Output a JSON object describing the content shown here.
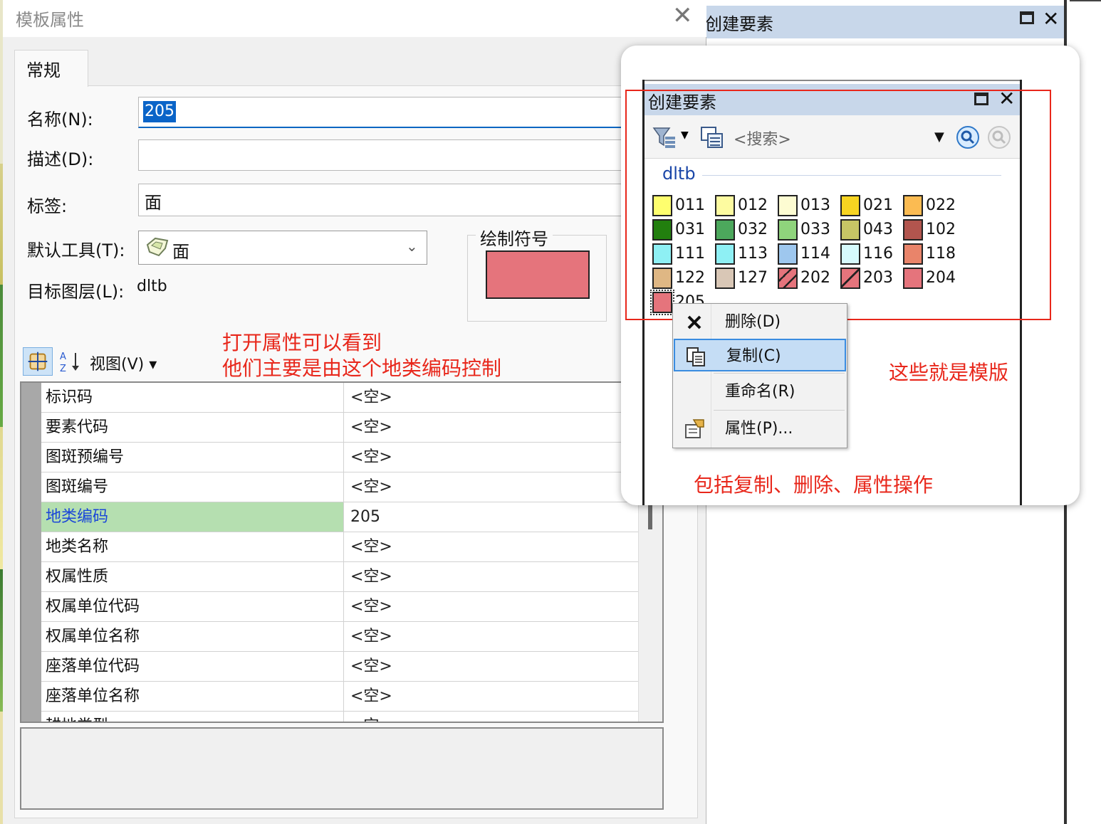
{
  "dialog": {
    "title": "模板属性",
    "close_glyph": "✕",
    "tab": "常规",
    "labels": {
      "name": "名称(N):",
      "description": "描述(D):",
      "tags": "标签:",
      "default_tool": "默认工具(T):",
      "target_layer": "目标图层(L):",
      "symbol": "绘制符号"
    },
    "name_value": "205",
    "description_value": "",
    "tags_value": "面",
    "default_tool_value": "面",
    "target_layer_value": "dltb",
    "symbol_color": "#e5747c",
    "view_label": "视图(V)",
    "view_caret": "▾"
  },
  "grid": {
    "rows": [
      {
        "name": "标识码",
        "value": "<空>"
      },
      {
        "name": "要素代码",
        "value": "<空>"
      },
      {
        "name": "图斑预编号",
        "value": "<空>"
      },
      {
        "name": "图斑编号",
        "value": "<空>"
      },
      {
        "name": "地类编码",
        "value": "205",
        "selected": true
      },
      {
        "name": "地类名称",
        "value": "<空>"
      },
      {
        "name": "权属性质",
        "value": "<空>"
      },
      {
        "name": "权属单位代码",
        "value": "<空>"
      },
      {
        "name": "权属单位名称",
        "value": "<空>"
      },
      {
        "name": "座落单位代码",
        "value": "<空>"
      },
      {
        "name": "座落单位名称",
        "value": "<空>"
      },
      {
        "name": "耕地类型",
        "value": "<空>"
      }
    ]
  },
  "annotations": {
    "left_line1": "打开属性可以看到",
    "left_line2": "他们主要是由这个地类编码控制",
    "templates": "这些就是模版",
    "operations": "包括复制、删除、属性操作"
  },
  "create_features": {
    "title": "创建要素",
    "search_placeholder": "<搜索>",
    "layer": "dltb",
    "max_glyph": "",
    "close_glyph": "✕",
    "templates": [
      {
        "code": "011",
        "color": "#fefe6e"
      },
      {
        "code": "012",
        "color": "#fdfba0"
      },
      {
        "code": "013",
        "color": "#fdfcd2"
      },
      {
        "code": "021",
        "color": "#f7d421"
      },
      {
        "code": "022",
        "color": "#fbbb52"
      },
      {
        "code": "031",
        "color": "#227f0e"
      },
      {
        "code": "032",
        "color": "#4ca85c"
      },
      {
        "code": "033",
        "color": "#8fd47c"
      },
      {
        "code": "043",
        "color": "#c7c565"
      },
      {
        "code": "102",
        "color": "#b2554e"
      },
      {
        "code": "111",
        "color": "#8ef0f4"
      },
      {
        "code": "113",
        "color": "#8ef0f4"
      },
      {
        "code": "114",
        "color": "#9ec7ee"
      },
      {
        "code": "116",
        "color": "#d6fafd"
      },
      {
        "code": "118",
        "color": "#e9846a"
      },
      {
        "code": "122",
        "color": "#dfb784"
      },
      {
        "code": "127",
        "color": "#d9c7b6"
      },
      {
        "code": "202",
        "color": "#e5747c",
        "hatch": "double"
      },
      {
        "code": "203",
        "color": "#e5747c",
        "hatch": "single"
      },
      {
        "code": "204",
        "color": "#e5747c"
      },
      {
        "code": "205",
        "color": "#e5747c",
        "selected": true
      }
    ]
  },
  "context_menu": {
    "items": [
      {
        "label": "删除(D)",
        "icon": "delete-icon"
      },
      {
        "label": "复制(C)",
        "icon": "copy-icon",
        "highlighted": true
      },
      {
        "label": "重命名(R)",
        "icon": ""
      },
      {
        "label": "属性(P)...",
        "icon": "properties-icon"
      }
    ]
  },
  "colors": {
    "annotation": "#e8271b",
    "title_bar": "#c8d7ea",
    "selected_row": "#b5dfb0",
    "menu_highlight": "#c5ddf5"
  }
}
